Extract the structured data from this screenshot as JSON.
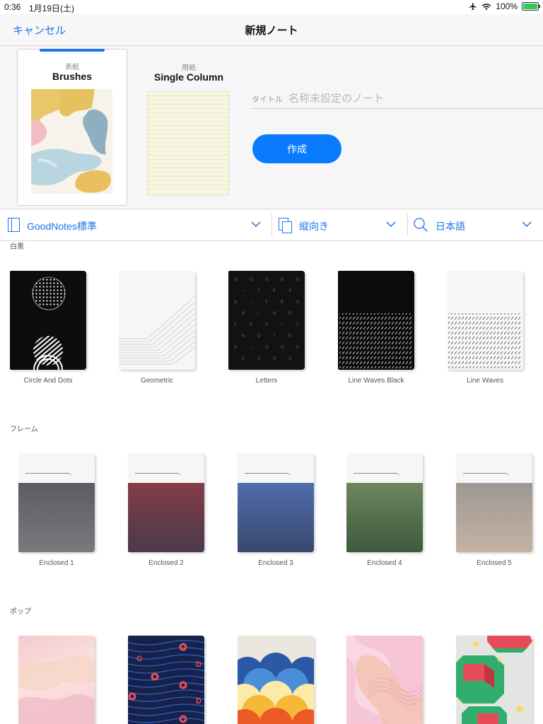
{
  "status": {
    "time": "0:36",
    "date": "1月19日(土)",
    "battery": "100%"
  },
  "nav": {
    "cancel": "キャンセル",
    "title": "新規ノート"
  },
  "cover_selector": {
    "kind_label": "表紙",
    "name": "Brushes"
  },
  "paper_selector": {
    "kind_label": "用紙",
    "name": "Single Column"
  },
  "title_field": {
    "label": "タイトル",
    "placeholder": "名称未設定のノート",
    "value": ""
  },
  "create_button": "作成",
  "filters": {
    "template_set": "GoodNotes標準",
    "orientation": "縦向き",
    "language": "日本語"
  },
  "sections": [
    {
      "title": "白黒",
      "items": [
        "Circle And Dots",
        "Geometric",
        "Letters",
        "Line Waves Black",
        "Line Waves"
      ]
    },
    {
      "title": "フレーム",
      "items": [
        "Enclosed 1",
        "Enclosed 2",
        "Enclosed 3",
        "Enclosed 4",
        "Enclosed 5"
      ]
    },
    {
      "title": "ポップ",
      "items": [
        "",
        "",
        "",
        "",
        ""
      ]
    }
  ],
  "frame_mark": ",",
  "colors": {
    "accent": "#1e74ea",
    "create_button": "#0a7aff"
  },
  "icons": [
    "airplane-icon",
    "wifi-icon",
    "battery-icon",
    "template-set-icon",
    "portrait-icon",
    "language-search-icon",
    "chevron-down-icon"
  ]
}
